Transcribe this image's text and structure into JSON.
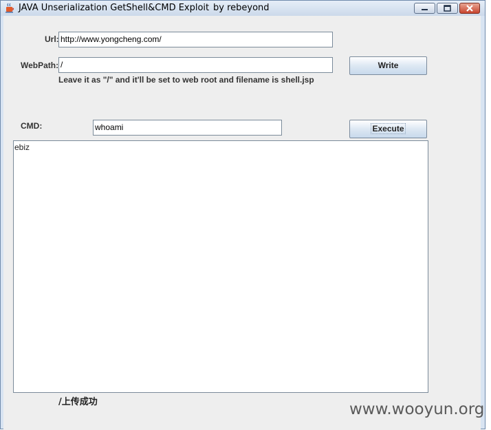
{
  "window": {
    "title": "JAVA Unserialization GetShell&CMD Exploit",
    "author": "by rebeyond"
  },
  "form": {
    "url_label": "Url:",
    "url_value": "http://www.yongcheng.com/",
    "webpath_label": "WebPath:",
    "webpath_value": "/",
    "write_button": "Write",
    "hint": "Leave it as \"/\" and it'll be set to web root and filename is shell.jsp",
    "cmd_label": "CMD:",
    "cmd_value": "whoami",
    "execute_button": "Execute"
  },
  "output": {
    "text": "ebiz"
  },
  "status": {
    "text": "/上传成功"
  },
  "watermark": {
    "text": "www.wooyun.org"
  }
}
